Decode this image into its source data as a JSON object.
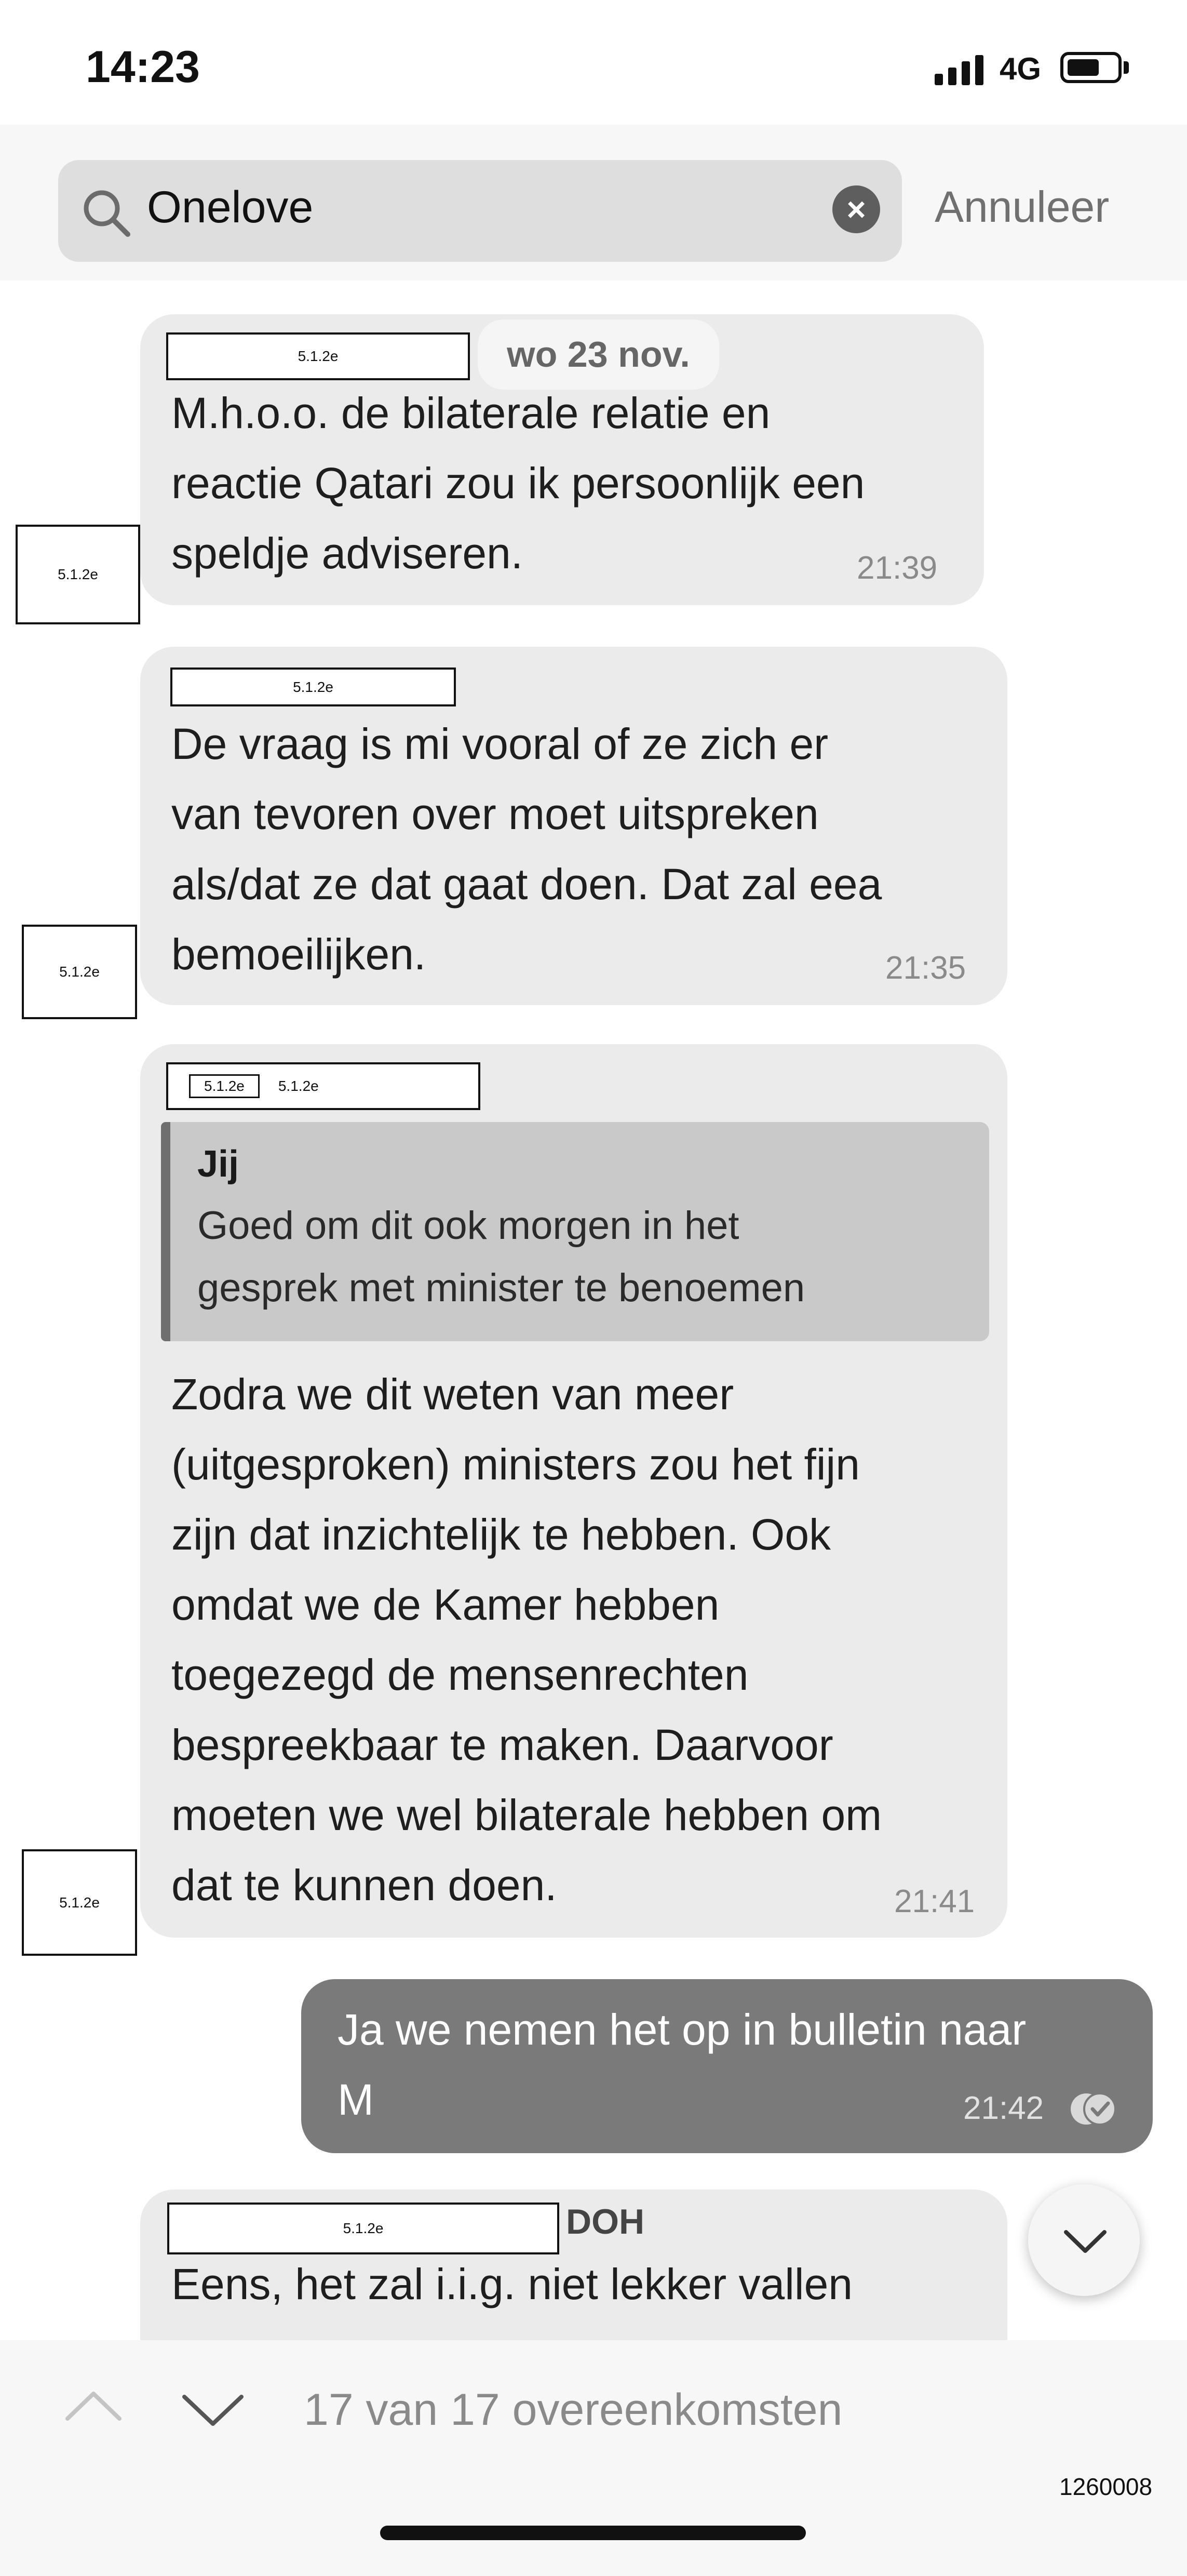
{
  "status_bar": {
    "time": "14:23",
    "network": "4G",
    "battery_level": 0.6
  },
  "search": {
    "query": "Onelove",
    "cancel_label": "Annuleer"
  },
  "redaction_code": "5.1.2e",
  "date_label": "wo 23 nov.",
  "messages": [
    {
      "lines": [
        "M.h.o.o. de bilaterale relatie en",
        "reactie Qatari zou ik persoonlijk een",
        "speldje adviseren."
      ],
      "time": "21:39"
    },
    {
      "lines": [
        "De vraag is mi vooral of ze zich er",
        "van tevoren over moet uitspreken",
        "als/dat ze dat gaat doen. Dat zal eea",
        "bemoeilijken."
      ],
      "time": "21:35"
    },
    {
      "quote_author": "Jij",
      "quote_lines": [
        "Goed om dit ook morgen in het",
        "gesprek met minister te benoemen"
      ],
      "lines": [
        "Zodra we dit weten van meer",
        "(uitgesproken) ministers zou het fijn",
        "zijn dat inzichtelijk te hebben. Ook",
        "omdat we de Kamer hebben",
        "toegezegd de mensenrechten",
        "bespreekbaar te maken. Daarvoor",
        "moeten we wel bilaterale hebben om",
        "dat te kunnen doen."
      ],
      "time": "21:41"
    },
    {
      "lines": [
        "Ja we nemen het op in bulletin naar",
        "M"
      ],
      "time": "21:42"
    },
    {
      "sender_suffix": "DOH",
      "lines": [
        "Eens, het zal i.i.g. niet lekker vallen"
      ]
    }
  ],
  "bottom_bar": {
    "match_count": "17 van 17 overeenkomsten"
  },
  "doc_id": "1260008"
}
